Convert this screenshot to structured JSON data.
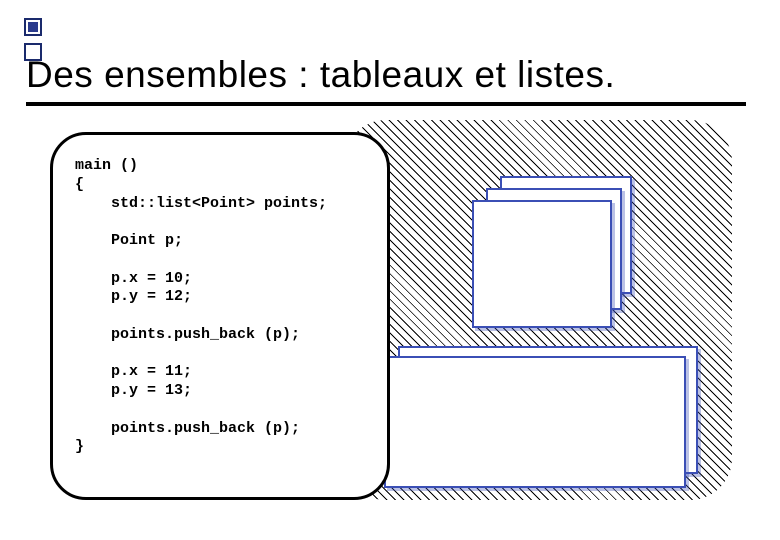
{
  "title": "Des ensembles : tableaux et listes.",
  "code": {
    "l1": "main ()",
    "l2": "{",
    "l3": "    std::list<Point> points;",
    "l4": "",
    "l5": "    Point p;",
    "l6": "",
    "l7": "    p.x = 10;",
    "l8": "    p.y = 12;",
    "l9": "",
    "l10": "    points.push_back (p);",
    "l11": "",
    "l12": "    p.x = 11;",
    "l13": "    p.y = 13;",
    "l14": "",
    "l15": "    points.push_back (p);",
    "l16": "}"
  }
}
